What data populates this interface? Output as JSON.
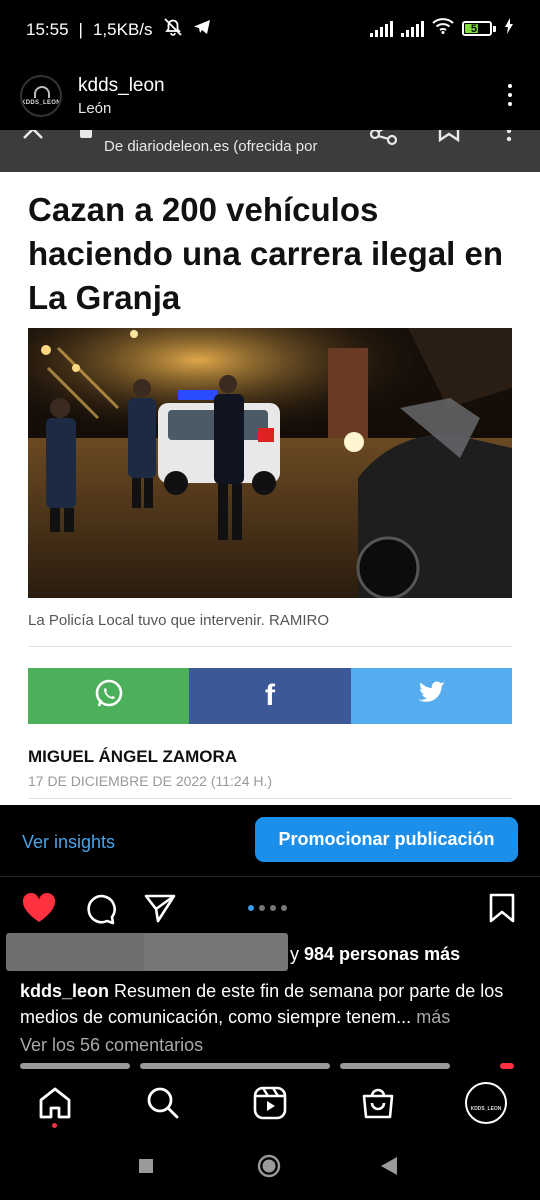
{
  "status_bar": {
    "time": "15:55",
    "speed": "1,5KB/s",
    "battery": "51",
    "battery_level": 0.51
  },
  "post_header": {
    "username": "kdds_leon",
    "location": "León",
    "avatar_logo": "KDDS_LEON"
  },
  "browser_bar": {
    "url_text": "De diariodeleon.es (ofrecida por"
  },
  "article": {
    "headline": "Cazan a 200 vehículos haciendo una carrera ilegal en La Granja",
    "photo_caption": "La Policía Local tuvo que intervenir. RAMIRO",
    "author": "MIGUEL ÁNGEL ZAMORA",
    "date": "17 DE DICIEMBRE DE 2022 (11:24 H.)",
    "share_colors": {
      "whatsapp": "#4cb05a",
      "facebook": "#3c5897",
      "twitter": "#55acee"
    }
  },
  "insights": {
    "view_insights": "Ver insights",
    "promote": "Promocionar publicación"
  },
  "likes": {
    "suffix_prefix": "y",
    "count_text": "984 personas más"
  },
  "caption": {
    "username": "kdds_leon",
    "text": "Resumen de este fin de semana por parte de los medios de comunicación, como siempre tenem...",
    "more": "más"
  },
  "comments": {
    "view_all": "Ver los 56 comentarios"
  },
  "icons": {
    "bottom_nav": [
      "home-icon",
      "search-icon",
      "reels-icon",
      "shop-icon",
      "profile-icon"
    ],
    "system_nav": [
      "recents-icon",
      "home-circle-icon",
      "back-icon"
    ]
  },
  "colors": {
    "accent": "#1b8fea",
    "like": "#ff3040",
    "link": "#4aa3e8"
  }
}
